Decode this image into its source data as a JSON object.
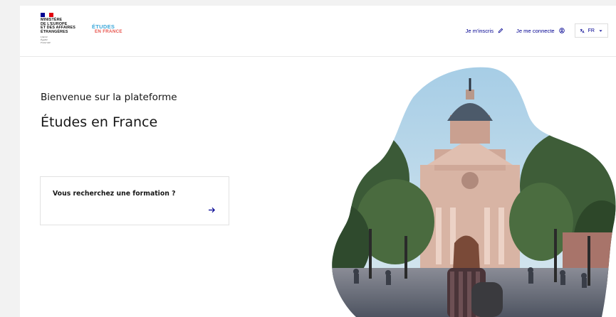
{
  "header": {
    "ministry_lines": [
      "Ministère",
      "de l'Europe",
      "et des affaires",
      "étrangères"
    ],
    "motto_lines": [
      "Liberté",
      "Égalité",
      "Fraternité"
    ],
    "brand_line1": "ÉTUDES",
    "brand_line2": "EN FRANCE",
    "nav": {
      "signup_label": "Je m'inscris",
      "login_label": "Je me connecte",
      "language_label": "FR"
    }
  },
  "hero": {
    "welcome": "Bienvenue sur la plateforme",
    "platform_name": "Études en France",
    "search_card_label": "Vous recherchez une formation ?"
  },
  "colors": {
    "primary_blue": "#000091",
    "brand_blue": "#3aa7d9",
    "brand_red": "#e8554e"
  },
  "icons": {
    "signup": "pencil-icon",
    "login": "account-circle-icon",
    "language": "translate-icon",
    "dropdown": "chevron-down-icon",
    "card": "arrow-right-icon"
  }
}
